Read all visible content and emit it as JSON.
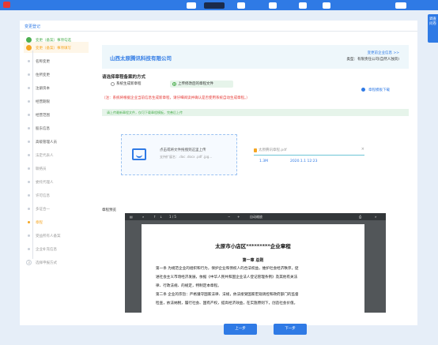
{
  "header": {
    "float_help": "调查问卷"
  },
  "card": {
    "title": "变更登记"
  },
  "steps": [
    {
      "label": "变更（备案）事项勾选",
      "state": "done"
    },
    {
      "label": "变更（备案）事项填写",
      "state": "current"
    },
    {
      "label": "名称变更",
      "state": "sub"
    },
    {
      "label": "住所变更",
      "state": "sub"
    },
    {
      "label": "注册资本",
      "state": "sub"
    },
    {
      "label": "经营期限",
      "state": "sub"
    },
    {
      "label": "经营范围",
      "state": "sub"
    },
    {
      "label": "股东信息",
      "state": "sub"
    },
    {
      "label": "高级管理人员",
      "state": "sub"
    },
    {
      "label": "法定代表人",
      "state": "sub-grey"
    },
    {
      "label": "联络员",
      "state": "sub-grey"
    },
    {
      "label": "委托代理人",
      "state": "sub-grey"
    },
    {
      "label": "许可信息",
      "state": "sub-grey"
    },
    {
      "label": "多证合一",
      "state": "sub-grey"
    },
    {
      "label": "章程",
      "state": "sub-active"
    },
    {
      "label": "受益所有人备案",
      "state": "sub-grey"
    },
    {
      "label": "企业补充信息",
      "state": "sub-grey"
    },
    {
      "label": "选择申报方式",
      "state": "todo"
    }
  ],
  "step_number_3": "3",
  "company": {
    "name": "山西太原腾讯科技有限公司",
    "change_link": "变更前企业信息 >>",
    "type": "类型：有限责任公司(自然人独资)"
  },
  "method": {
    "title": "请选择章程备案的方式",
    "option_online": "系统生成新章程",
    "option_upload": "上传修改后的章程文件",
    "download": "章程模板下载",
    "note": "（注：系统将根据企业当前信息生成新章程，请仔细阅读并确认是否使用系统自动生成章程。）",
    "alert": "请上传最新章程文件，仅可下载章程模板，完善后上传"
  },
  "upload": {
    "main": "点击或将文件拖拽到这里上传",
    "sub": "支持扩展名：.doc .docx .pdf .jpg..."
  },
  "file": {
    "name": "太原腾讯章程.pdf",
    "size": "1.3M",
    "date": "2020.1.1 12:23",
    "close": "×"
  },
  "preview": {
    "title": "章程预览",
    "toolbar_page": "1 / 5",
    "toolbar_zoom": "自动缩放",
    "doc_title": "太原市小店区*********企业章程",
    "doc_h1": "第一章  总则",
    "lines": [
      "第一条  为规范企业的组织和行为，保护企业和债权人的合法权益，维护社会经济秩序，促",
      "进社会主义市场经济发展，依据《中华人民共和国企业法人登记管理条例》及其他有关法",
      "律、行政法规、的规定，特制定本章程。",
      "第二条  企业的宗旨：严格遵守国家法律、法规，依法接受国家宏观调控和政府部门的监督",
      "检查，依法纳税，履行社会、国有产权，提高经济效益，在实施原则下，创造社会价值。"
    ]
  },
  "buttons": {
    "prev": "上一步",
    "next": "下一步"
  },
  "colors": {
    "primary": "#2f7ae5",
    "success": "#4caf50",
    "warning": "#f5a623",
    "danger": "#e53935"
  }
}
